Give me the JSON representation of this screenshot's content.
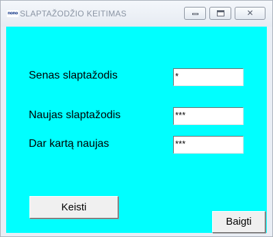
{
  "window": {
    "icon_text": "nono",
    "title": "SLAPTAŽODŽIO KEITIMAS",
    "minimize_glyph": "",
    "maximize_glyph": "",
    "close_glyph": "✕"
  },
  "form": {
    "old_password": {
      "label": "Senas slaptažodis",
      "value": "*"
    },
    "new_password": {
      "label": "Naujas slaptažodis",
      "value": "***"
    },
    "repeat_password": {
      "label": "Dar kartą naujas",
      "value": "***"
    },
    "change_button": "Keisti",
    "finish_button": "Baigti"
  },
  "colors": {
    "client_background": "#00ffff"
  }
}
